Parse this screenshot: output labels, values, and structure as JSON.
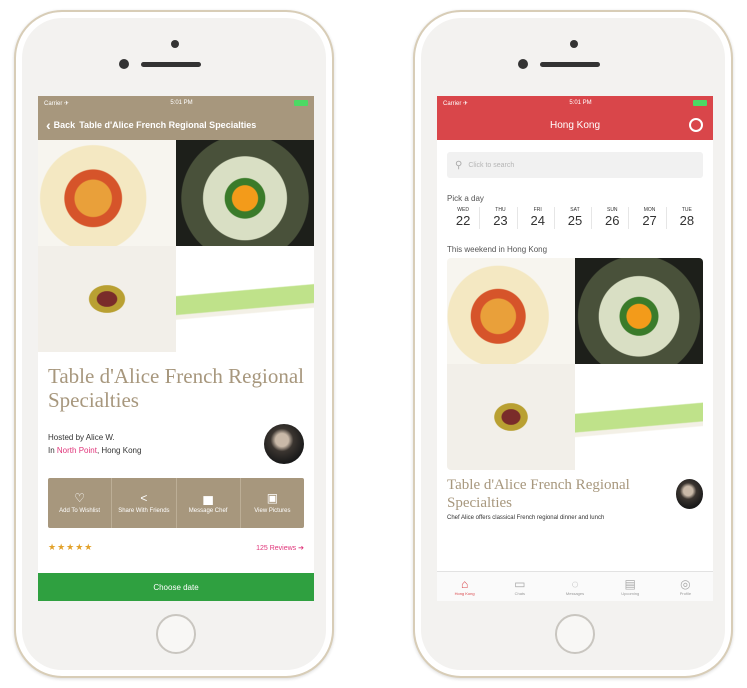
{
  "left_screen": {
    "status": {
      "carrier": "Carrier ✈",
      "time": "5:01 PM"
    },
    "nav": {
      "back_label": "Back",
      "title": "Table d'Alice French Regional Specialties"
    },
    "listing_title": "Table d'Alice French Regional Specialties",
    "host_line": "Hosted by Alice W.",
    "location_prefix": "In",
    "location_link": "North Point",
    "location_suffix": ", Hong Kong",
    "actions": [
      {
        "icon": "heart-icon",
        "glyph": "♡",
        "label": "Add To Wishlist"
      },
      {
        "icon": "share-icon",
        "glyph": "<",
        "label": "Share With Friends"
      },
      {
        "icon": "message-icon",
        "glyph": "▅",
        "label": "Message Chef"
      },
      {
        "icon": "pictures-icon",
        "glyph": "▣",
        "label": "View Pictures"
      }
    ],
    "rating_stars": "★★★★★",
    "reviews_label": "125 Reviews ➔",
    "cta_label": "Choose date",
    "colors": {
      "brand": "#a7977d",
      "cta": "#2fa040",
      "accent": "#e0357a"
    }
  },
  "right_screen": {
    "status": {
      "carrier": "Carrier ✈",
      "time": "5:01 PM"
    },
    "nav": {
      "title": "Hong Kong"
    },
    "search": {
      "placeholder": "Click to search"
    },
    "pick_label": "Pick a day",
    "days": [
      {
        "name": "WED",
        "date": "22"
      },
      {
        "name": "THU",
        "date": "23"
      },
      {
        "name": "FRI",
        "date": "24"
      },
      {
        "name": "SAT",
        "date": "25"
      },
      {
        "name": "SUN",
        "date": "26"
      },
      {
        "name": "MON",
        "date": "27"
      },
      {
        "name": "TUE",
        "date": "28"
      }
    ],
    "section_label": "This weekend in Hong Kong",
    "card_title": "Table d'Alice French Regional Specialties",
    "card_desc": "Chef Alice offers classical French regional dinner and lunch",
    "tabs": [
      {
        "icon": "home-icon",
        "glyph": "⌂",
        "label": "Hong Kong"
      },
      {
        "icon": "map-icon",
        "glyph": "▭",
        "label": "Chats"
      },
      {
        "icon": "chat-icon",
        "glyph": "◌",
        "label": "Messages"
      },
      {
        "icon": "calendar-icon",
        "glyph": "▤",
        "label": "Upcoming"
      },
      {
        "icon": "profile-icon",
        "glyph": "◎",
        "label": "Profile"
      }
    ],
    "colors": {
      "brand": "#d9464a"
    }
  }
}
